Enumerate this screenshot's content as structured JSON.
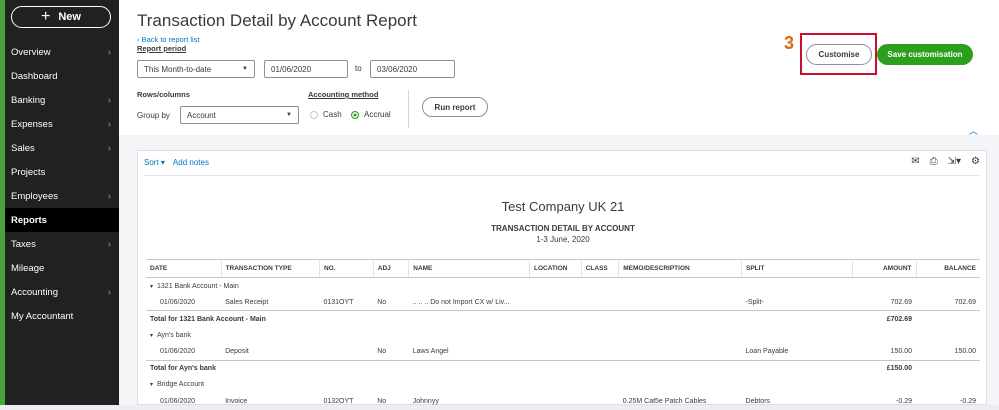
{
  "sidebar": {
    "new_label": "New",
    "items": [
      {
        "label": "Overview",
        "chevron": true
      },
      {
        "label": "Dashboard",
        "chevron": false
      },
      {
        "label": "Banking",
        "chevron": true
      },
      {
        "label": "Expenses",
        "chevron": true
      },
      {
        "label": "Sales",
        "chevron": true
      },
      {
        "label": "Projects",
        "chevron": false
      },
      {
        "label": "Employees",
        "chevron": true
      },
      {
        "label": "Reports",
        "chevron": false,
        "active": true
      },
      {
        "label": "Taxes",
        "chevron": true
      },
      {
        "label": "Mileage",
        "chevron": false
      },
      {
        "label": "Accounting",
        "chevron": true
      },
      {
        "label": "My Accountant",
        "chevron": false
      }
    ]
  },
  "header": {
    "title": "Transaction Detail by Account Report",
    "back_link": "Back to report list",
    "report_period_label": "Report period",
    "period_select": "This Month-to-date",
    "date_from": "01/06/2020",
    "to_label": "to",
    "date_to": "03/06/2020",
    "rows_columns_label": "Rows/columns",
    "group_by_label": "Group by",
    "group_by_value": "Account",
    "accounting_method_label": "Accounting method",
    "cash_label": "Cash",
    "accrual_label": "Accrual",
    "run_report_label": "Run report",
    "customise_label": "Customise",
    "save_customisation_label": "Save customisation",
    "step_number": "3"
  },
  "colors": {
    "brand_green": "#2ca01c",
    "link_blue": "#0077c5",
    "highlight_red": "#c8102e",
    "step_orange": "#d86a14"
  },
  "report": {
    "sort_label": "Sort",
    "add_notes_label": "Add notes",
    "company": "Test Company UK 21",
    "name": "TRANSACTION DETAIL BY ACCOUNT",
    "date_range": "1-3 June, 2020",
    "columns": [
      "DATE",
      "TRANSACTION TYPE",
      "NO.",
      "ADJ",
      "NAME",
      "LOCATION",
      "CLASS",
      "MEMO/DESCRIPTION",
      "SPLIT",
      "AMOUNT",
      "BALANCE"
    ],
    "rows": [
      {
        "kind": "group",
        "label": "1321 Bank Account - Main"
      },
      {
        "kind": "data",
        "cells": [
          "01/06/2020",
          "Sales Receipt",
          "0131OYT",
          "No",
          ".. .. .. Do not Import CX w/ Liv...",
          "",
          "",
          "",
          "-Split-",
          "702.69",
          "702.69"
        ]
      },
      {
        "kind": "total",
        "label": "Total for 1321 Bank Account - Main",
        "amount": "£702.69"
      },
      {
        "kind": "group",
        "label": "Ayn's bank"
      },
      {
        "kind": "data",
        "cells": [
          "01/06/2020",
          "Deposit",
          "",
          "No",
          "Laws Angel",
          "",
          "",
          "",
          "Loan Payable",
          "150.00",
          "150.00"
        ]
      },
      {
        "kind": "total",
        "label": "Total for Ayn's bank",
        "amount": "£150.00"
      },
      {
        "kind": "group",
        "label": "Bridge Account"
      },
      {
        "kind": "data",
        "cells": [
          "01/06/2020",
          "Invoice",
          "0132OYT",
          "No",
          "Johnnyy",
          "",
          "",
          "0.25M Cat5e Patch Cables",
          "Debtors",
          "-0.29",
          "-0.29"
        ]
      }
    ]
  }
}
